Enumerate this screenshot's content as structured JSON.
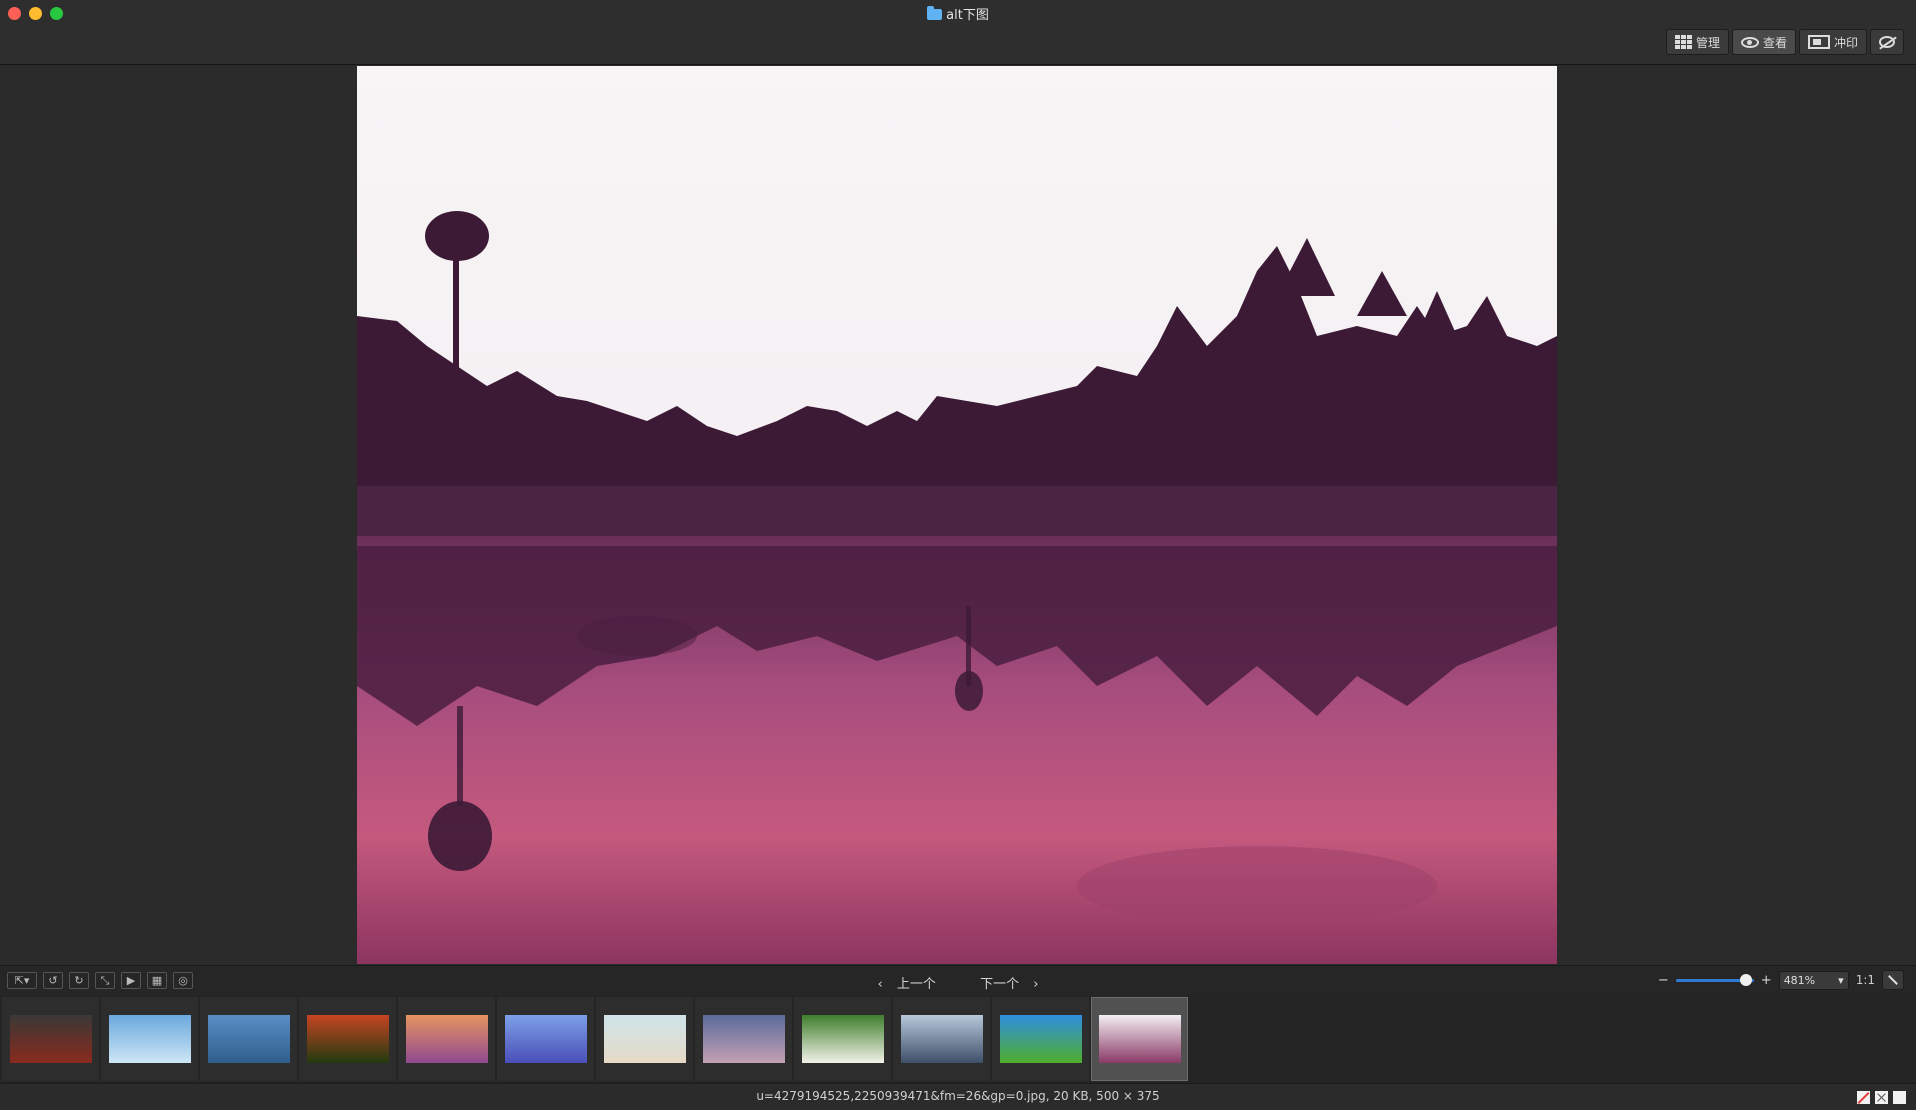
{
  "window": {
    "title": "alt下图",
    "folder_icon": "folder-icon"
  },
  "modes": [
    {
      "label": "管理",
      "icon": "grid-icon"
    },
    {
      "label": "查看",
      "icon": "eye-icon"
    },
    {
      "label": "冲印",
      "icon": "print-icon"
    },
    {
      "label": "",
      "icon": "hide-icon"
    }
  ],
  "toolbar": {
    "prev_label": "上一个",
    "next_label": "下一个",
    "zoom_value": "481%",
    "zoom_slider_fraction": 0.9,
    "zoom_minus": "−",
    "zoom_plus": "+",
    "ratio_label": "1:1",
    "tool_icons": [
      "export-icon",
      "rotate-left-icon",
      "rotate-right-icon",
      "resize-icon",
      "slideshow-icon",
      "crop-icon",
      "adjust-icon"
    ]
  },
  "filmstrip": [
    {
      "name": "car",
      "colors": [
        "#3a3836",
        "#8a2a1e"
      ]
    },
    {
      "name": "dandelion",
      "colors": [
        "#6aa8dc",
        "#cde6f6"
      ]
    },
    {
      "name": "lake",
      "colors": [
        "#5a8fc6",
        "#2e5e8a"
      ]
    },
    {
      "name": "sunset-field",
      "colors": [
        "#c64522",
        "#223a10"
      ]
    },
    {
      "name": "flowers-sky",
      "colors": [
        "#e79460",
        "#8f4a8f"
      ]
    },
    {
      "name": "mountains-purple",
      "colors": [
        "#7da0e8",
        "#4a4fb8"
      ]
    },
    {
      "name": "beach",
      "colors": [
        "#cfe3ea",
        "#e7dbc6"
      ]
    },
    {
      "name": "lake-dusk",
      "colors": [
        "#5c6b9c",
        "#c4a0b4"
      ]
    },
    {
      "name": "daisies",
      "colors": [
        "#3e7e2c",
        "#f2f2e8"
      ]
    },
    {
      "name": "windsurf",
      "colors": [
        "#b6c8da",
        "#3e5068"
      ]
    },
    {
      "name": "green-field",
      "colors": [
        "#2e8fe0",
        "#4fae2a"
      ]
    },
    {
      "name": "temple-reflection",
      "colors": [
        "#f3eef1",
        "#8a3a66"
      ]
    }
  ],
  "selected_thumb": 11,
  "status": {
    "text": "u=4279194525,2250939471&fm=26&gp=0.jpg, 20 KB, 500 × 375"
  },
  "colors": {
    "accent": "#2f7bd6",
    "close": "#fe5f57",
    "minimize": "#febc2e",
    "maximize": "#28c840"
  }
}
